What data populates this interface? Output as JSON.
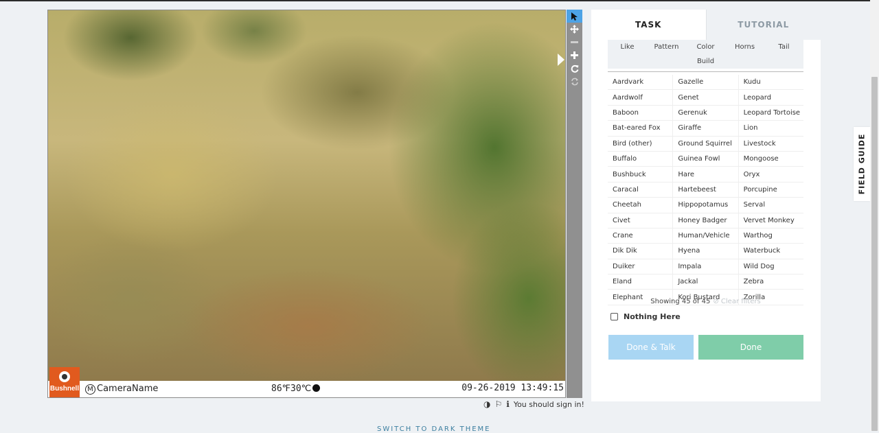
{
  "viewer": {
    "camera_name": "CameraName",
    "temperature": "86℉30℃",
    "datetime": "09-26-2019 13:49:15",
    "brand": "Bushnell",
    "tools": [
      "pointer-icon",
      "move-icon",
      "zoom-out-icon",
      "zoom-in-icon",
      "rotate-icon",
      "reset-icon"
    ]
  },
  "below_viewer": {
    "sign_in_text": "You should sign in!"
  },
  "footer": {
    "dark_theme_link": "SWITCH TO DARK THEME"
  },
  "panel": {
    "tabs": [
      {
        "label": "TASK",
        "active": true
      },
      {
        "label": "TUTORIAL",
        "active": false
      }
    ],
    "filters": [
      "Like",
      "Pattern",
      "Color",
      "Horns",
      "Tail",
      "Build"
    ],
    "species_rows": [
      [
        "Aardvark",
        "Gazelle",
        "Kudu"
      ],
      [
        "Aardwolf",
        "Genet",
        "Leopard"
      ],
      [
        "Baboon",
        "Gerenuk",
        "Leopard Tortoise"
      ],
      [
        "Bat-eared Fox",
        "Giraffe",
        "Lion"
      ],
      [
        "Bird (other)",
        "Ground Squirrel",
        "Livestock"
      ],
      [
        "Buffalo",
        "Guinea Fowl",
        "Mongoose"
      ],
      [
        "Bushbuck",
        "Hare",
        "Oryx"
      ],
      [
        "Caracal",
        "Hartebeest",
        "Porcupine"
      ],
      [
        "Cheetah",
        "Hippopotamus",
        "Serval"
      ],
      [
        "Civet",
        "Honey Badger",
        "Vervet Monkey"
      ],
      [
        "Crane",
        "Human/Vehicle",
        "Warthog"
      ],
      [
        "Dik Dik",
        "Hyena",
        "Waterbuck"
      ],
      [
        "Duiker",
        "Impala",
        "Wild Dog"
      ],
      [
        "Eland",
        "Jackal",
        "Zebra"
      ],
      [
        "Elephant",
        "Kori Bustard",
        "Zorilla"
      ]
    ],
    "showing": "Showing 45 of 45",
    "clear_filters": "⊘ Clear filters",
    "nothing_here": "Nothing Here",
    "done_talk_label": "Done & Talk",
    "done_label": "Done"
  },
  "field_guide": {
    "label": "FIELD GUIDE"
  },
  "colors": {
    "accent_blue": "#4da3e6",
    "done_green": "#7fcda9",
    "talk_blue": "#a9d6f3"
  }
}
